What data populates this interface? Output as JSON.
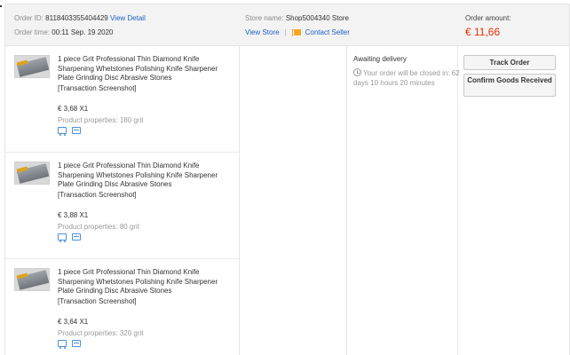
{
  "order": {
    "id_label": "Order ID:",
    "id_value": "811840335540442",
    "id_value_tail": "9",
    "view_detail": "View Detail",
    "time_label": "Order time:",
    "time_value": "00:11 Sep. 19 2020",
    "store_label": "Store name:",
    "store_value": "Shop5004340 Store",
    "view_store": "View Store",
    "separator": "|",
    "contact_seller": "Contact Seller",
    "amount_label": "Order amount:",
    "amount_value": "€ 11,66"
  },
  "colors": {
    "accent_link": "#1f5fc4",
    "amount": "#e62e04",
    "mail_icon": "#f5a623"
  },
  "items": [
    {
      "title": "1 piece Grit Professional Thin Diamond Knife Sharpening Whetstones Polishing Knife Sharpener Plate Grinding Disc Abrasive Stones",
      "snapshot": "[Transaction Screenshot]",
      "price": "€ 3,68 X1",
      "props": "Product properties: 180 grit"
    },
    {
      "title": "1 piece Grit Professional Thin Diamond Knife Sharpening Whetstones Polishing Knife Sharpener Plate Grinding Disc Abrasive Stones",
      "snapshot": "[Transaction Screenshot]",
      "price": "€ 3,88 X1",
      "props": "Product properties: 80 grit"
    },
    {
      "title": "1 piece Grit Professional Thin Diamond Knife Sharpening Whetstones Polishing Knife Sharpener Plate Grinding Disc Abrasive Stones",
      "snapshot": "[Transaction Screenshot]",
      "price": "€ 3,64 X1",
      "props": "Product properties: 320 grit"
    }
  ],
  "status": {
    "label": "Awaiting delivery",
    "note": "Your order will be closed in: 62 days 10 hours 20 minutes"
  },
  "actions": {
    "track_order": "Track Order",
    "confirm_received": "Confirm Goods Received"
  },
  "icons": [
    "clock-icon",
    "mail-icon",
    "truck-icon",
    "card-icon",
    "product-thumbnail"
  ]
}
